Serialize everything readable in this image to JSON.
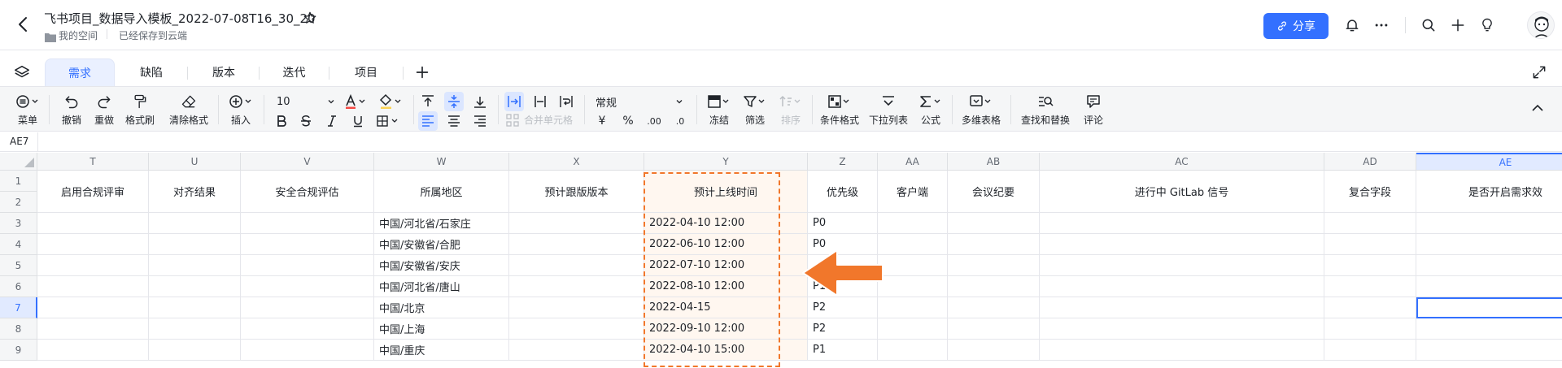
{
  "header": {
    "doc_title": "飞书项目_数据导入模板_2022-07-08T16_30_20",
    "breadcrumb_space": "我的空间",
    "save_status": "已经保存到云端",
    "share_label": "分享"
  },
  "sheets": {
    "tabs": [
      "需求",
      "缺陷",
      "版本",
      "迭代",
      "项目"
    ],
    "active_index": 0
  },
  "toolbar": {
    "menu": "菜单",
    "undo": "撤销",
    "redo": "重做",
    "format_painter": "格式刷",
    "clear_format": "清除格式",
    "insert": "插入",
    "font_size": "10",
    "merge_cells": "合并单元格",
    "number_format": "常规",
    "currency_symbol": "¥",
    "percent_symbol": "%",
    "decrease_decimal": ".00",
    "increase_decimal": ".0",
    "freeze": "冻结",
    "filter": "筛选",
    "sort": "排序",
    "conditional_format": "条件格式",
    "dropdown_list": "下拉列表",
    "formula": "公式",
    "multi_table": "多维表格",
    "find_replace": "查找和替换",
    "comment": "评论"
  },
  "formula_bar": {
    "cell_ref": "AE7"
  },
  "grid": {
    "columns": [
      "T",
      "U",
      "V",
      "W",
      "X",
      "Y",
      "Z",
      "AA",
      "AB",
      "AC",
      "AD",
      "AE"
    ],
    "selected_column": "AE",
    "rows": [
      "1",
      "2",
      "3",
      "4",
      "5",
      "6",
      "7",
      "8",
      "9"
    ],
    "selected_row": "7",
    "headers": [
      "启用合规评审",
      "对齐结果",
      "安全合规评估",
      "所属地区",
      "预计跟版版本",
      "预计上线时间",
      "优先级",
      "客户端",
      "会议纪要",
      "进行中 GitLab 信号",
      "复合字段",
      "是否开启需求效"
    ],
    "region": [
      "中国/河北省/石家庄",
      "中国/安徽省/合肥",
      "中国/安徽省/安庆",
      "中国/河北省/唐山",
      "中国/北京",
      "中国/上海",
      "中国/重庆"
    ],
    "launch_time": [
      "2022-04-10 12:00",
      "2022-06-10 12:00",
      "2022-07-10 12:00",
      "2022-08-10 12:00",
      "2022-04-15",
      "2022-09-10 12:00",
      "2022-04-10 15:00"
    ],
    "priority": [
      "P0",
      "P0",
      "",
      "P1",
      "P2",
      "P2",
      "P1"
    ]
  },
  "colors": {
    "accent": "#3370ff",
    "highlight": "#f1772b"
  }
}
